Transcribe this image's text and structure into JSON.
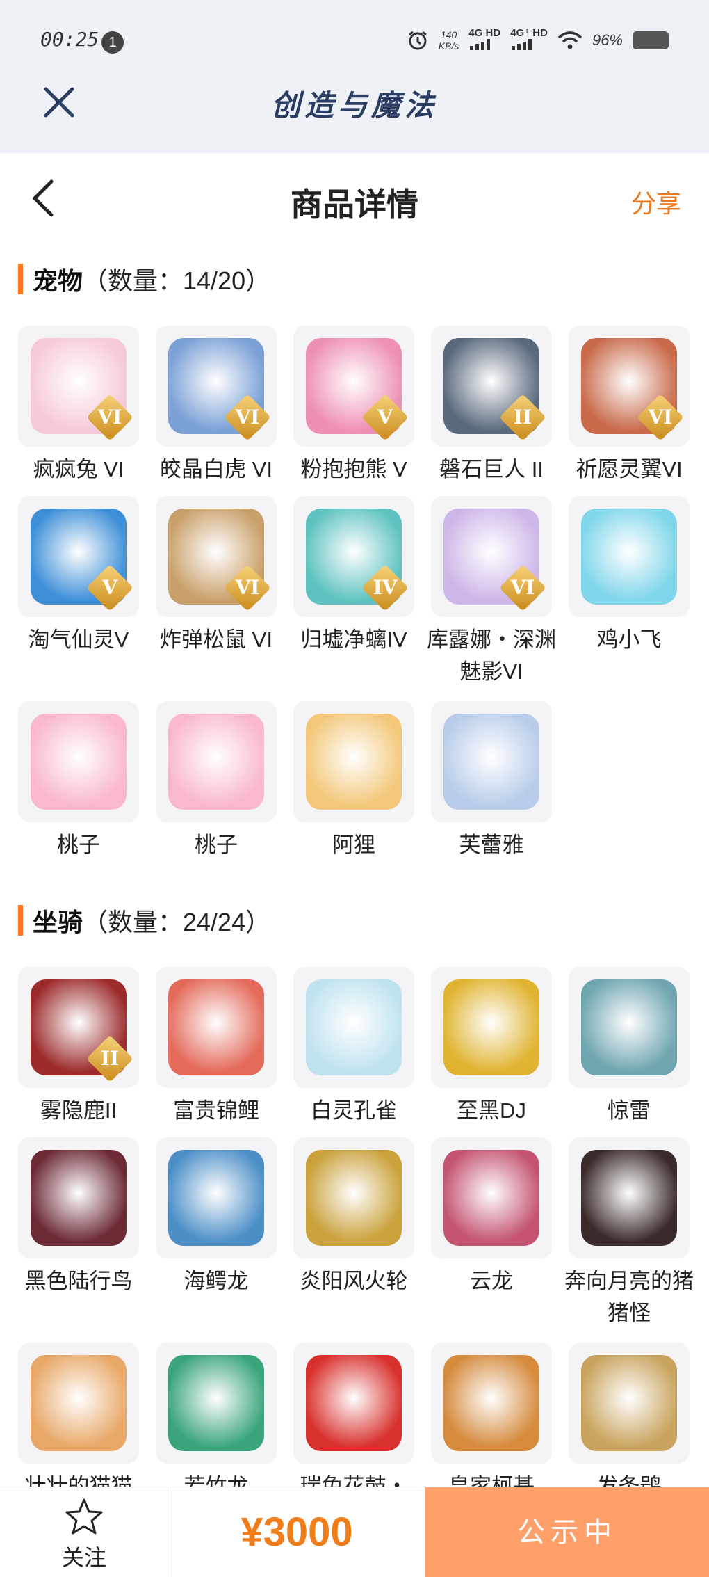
{
  "status_bar": {
    "time": "00:25",
    "notification_count": "1",
    "speed_value": "140",
    "speed_unit": "KB/s",
    "network1": "4G HD",
    "network2": "4G⁺ HD",
    "battery": "96%"
  },
  "app": {
    "title": "创造与魔法"
  },
  "header": {
    "title": "商品详情",
    "share_label": "分享"
  },
  "pets_section": {
    "name": "宠物",
    "count": "（数量：14/20）",
    "items": [
      {
        "name": "疯疯兔 VI",
        "rank": "VI",
        "color": "#f6c9d9"
      },
      {
        "name": "皎晶白虎 VI",
        "rank": "VI",
        "color": "#7aa0d6"
      },
      {
        "name": "粉抱抱熊 V",
        "rank": "V",
        "color": "#ee8fb5"
      },
      {
        "name": "磐石巨人 II",
        "rank": "II",
        "color": "#5a6a7c"
      },
      {
        "name": "祈愿灵翼VI",
        "rank": "VI",
        "color": "#c96a4a"
      },
      {
        "name": "淘气仙灵V",
        "rank": "V",
        "color": "#3d8fd8"
      },
      {
        "name": "炸弹松鼠 VI",
        "rank": "VI",
        "color": "#c9a06a"
      },
      {
        "name": "归墟净螭IV",
        "rank": "IV",
        "color": "#5ec3c0"
      },
      {
        "name": "库露娜・深渊魅影VI",
        "rank": "VI",
        "color": "#cdb6e8"
      },
      {
        "name": "鸡小飞",
        "rank": "",
        "color": "#7fd6ea"
      },
      {
        "name": "桃子",
        "rank": "",
        "color": "#f9b8cd"
      },
      {
        "name": "桃子",
        "rank": "",
        "color": "#f9b8cd"
      },
      {
        "name": "阿狸",
        "rank": "",
        "color": "#f3c87a"
      },
      {
        "name": "芙蕾雅",
        "rank": "",
        "color": "#b9cdea"
      }
    ]
  },
  "mounts_section": {
    "name": "坐骑",
    "count": "（数量：24/24）",
    "items": [
      {
        "name": "雾隐鹿II",
        "rank": "II",
        "color": "#9c2b2b"
      },
      {
        "name": "富贵锦鲤",
        "rank": "",
        "color": "#e46a5a"
      },
      {
        "name": "白灵孔雀",
        "rank": "",
        "color": "#bfe3ee"
      },
      {
        "name": "至黑DJ",
        "rank": "",
        "color": "#e0b431"
      },
      {
        "name": "惊雷",
        "rank": "",
        "color": "#6fa6b0"
      },
      {
        "name": "黑色陆行鸟",
        "rank": "",
        "color": "#6b2a34"
      },
      {
        "name": "海鳄龙",
        "rank": "",
        "color": "#4c8fc7"
      },
      {
        "name": "炎阳风火轮",
        "rank": "",
        "color": "#caa13a"
      },
      {
        "name": "云龙",
        "rank": "",
        "color": "#c45470"
      },
      {
        "name": "奔向月亮的猪猪怪",
        "rank": "",
        "color": "#3b2a2a"
      },
      {
        "name": "壮壮的猫猫",
        "rank": "",
        "color": "#e8a868"
      },
      {
        "name": "若竹龙",
        "rank": "",
        "color": "#3aa57a"
      },
      {
        "name": "瑞兔花鼓・",
        "rank": "",
        "color": "#d8302c"
      },
      {
        "name": "皇家柯基",
        "rank": "",
        "color": "#d58a3c"
      },
      {
        "name": "发条鸮",
        "rank": "",
        "color": "#c9a45e"
      }
    ]
  },
  "bottom_bar": {
    "follow_label": "关注",
    "price": "¥3000",
    "status_label": "公示中"
  }
}
